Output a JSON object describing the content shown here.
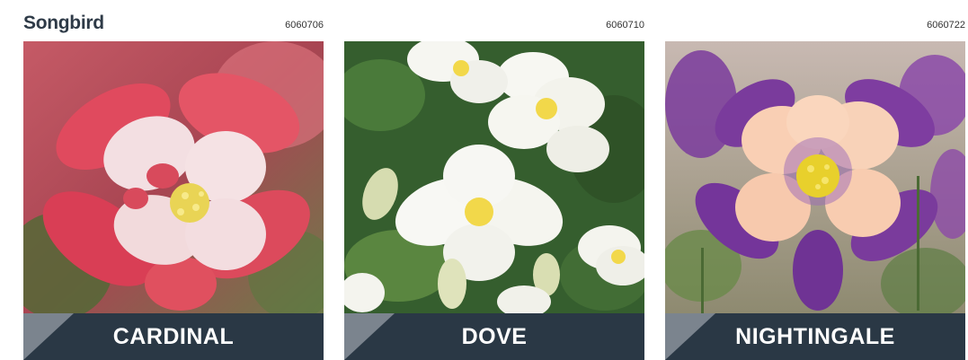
{
  "series": {
    "title": "Songbird"
  },
  "cards": [
    {
      "code": "6060706",
      "name": "CARDINAL",
      "image": "red-white-columbine-photo",
      "colors": {
        "petal": "#e04a5e",
        "center": "#f7e4e6",
        "background": "#b7515c"
      }
    },
    {
      "code": "6060710",
      "name": "DOVE",
      "image": "white-columbine-photo",
      "colors": {
        "petal": "#f7f7f2",
        "center": "#f2d84a",
        "background": "#3e6b34"
      }
    },
    {
      "code": "6060722",
      "name": "NIGHTINGALE",
      "image": "purple-peach-columbine-photo",
      "colors": {
        "petal": "#7a3b9c",
        "center": "#f9cfb4",
        "background": "#b9a59c"
      }
    }
  ],
  "colors": {
    "label_bar": "#2a3845",
    "title_text": "#2e3a47"
  }
}
